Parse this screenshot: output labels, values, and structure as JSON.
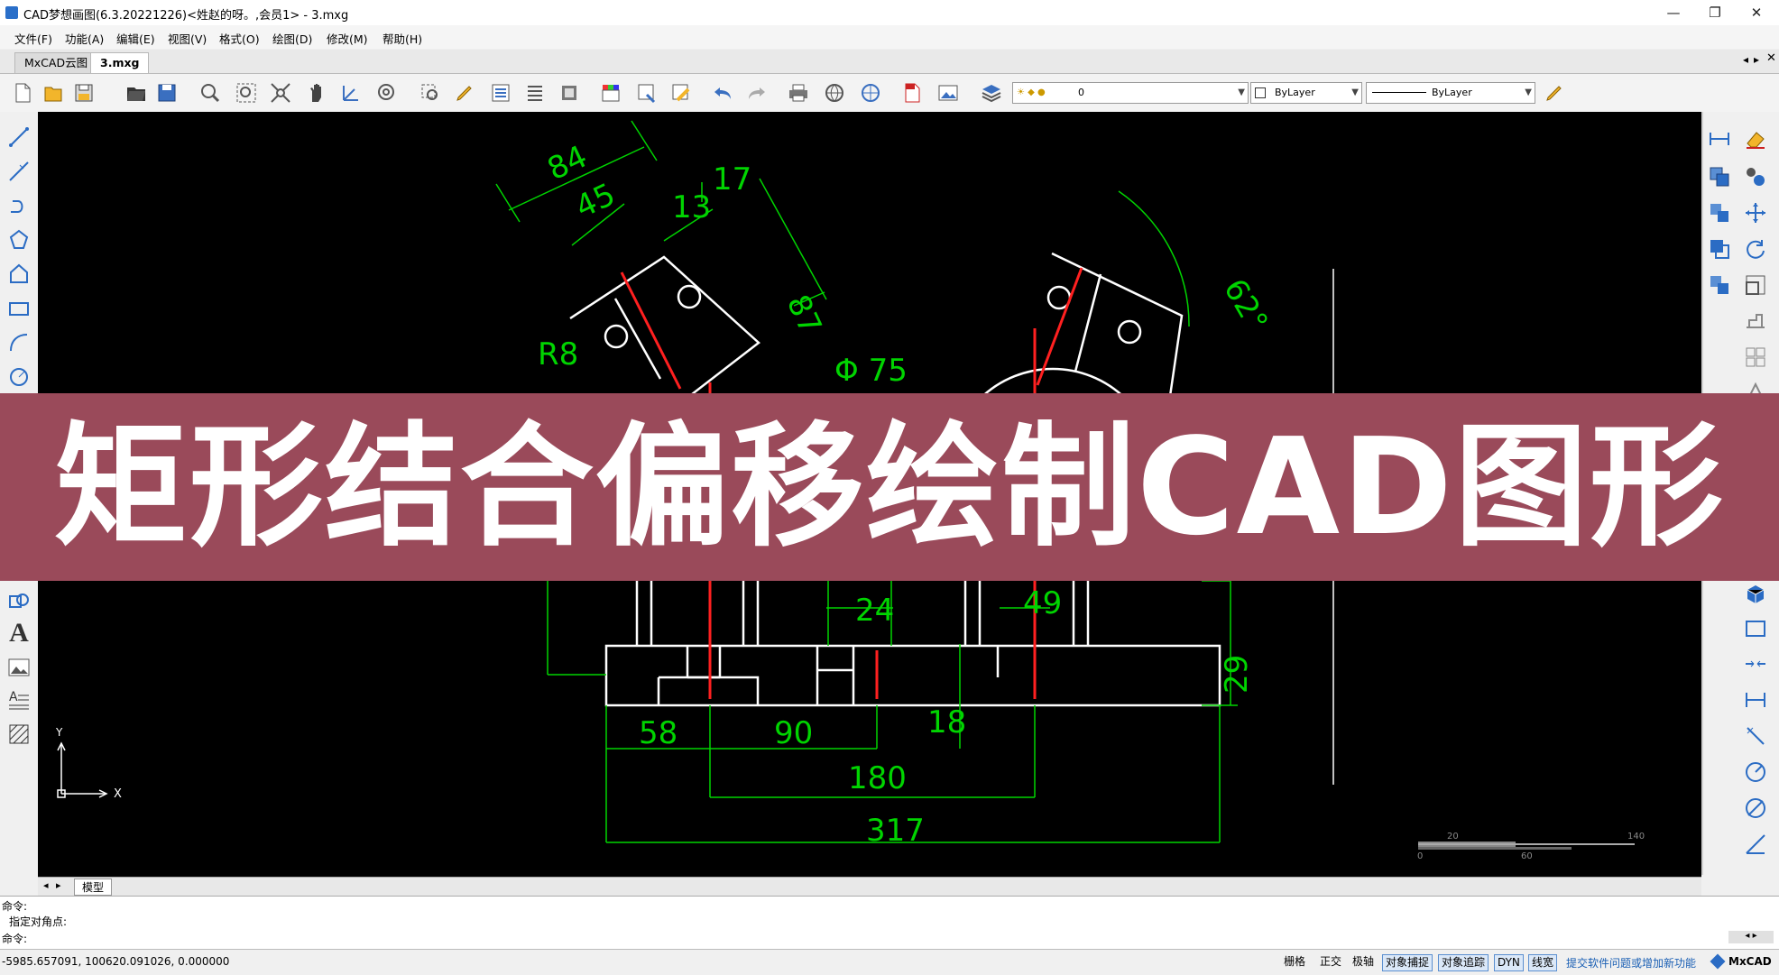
{
  "window": {
    "title": "CAD梦想画图(6.3.20221226)<姓赵的呀。,会员1> - 3.mxg",
    "controls": [
      "—",
      "❐",
      "✕"
    ]
  },
  "menu": {
    "items": [
      "文件(F)",
      "功能(A)",
      "编辑(E)",
      "视图(V)",
      "格式(O)",
      "绘图(D)",
      "修改(M)",
      "帮助(H)"
    ]
  },
  "tabs": {
    "items": [
      "MxCAD云图",
      "3.mxg"
    ],
    "active": "3.mxg"
  },
  "toolbar": {
    "layer_value": "0",
    "color_value": "ByLayer",
    "linetype_value": "ByLayer"
  },
  "drawing": {
    "dims": {
      "d84": "84",
      "d45": "45",
      "d13": "13",
      "d17": "17",
      "d87": "87",
      "r8": "R8",
      "phi75": "Φ 75",
      "a62": "62°",
      "d24": "24",
      "d49": "49",
      "d29": "29",
      "d18": "18",
      "d58": "58",
      "d90": "90",
      "d180": "180",
      "d317": "317"
    },
    "ucs": {
      "x": "X",
      "y": "Y"
    },
    "scale": {
      "s0": "0",
      "s20": "20",
      "s60": "60",
      "s140": "140"
    },
    "colors": {
      "dim": "#00d400",
      "geometry": "#ffffff",
      "center": "#ff2020",
      "background": "#000000"
    }
  },
  "banner": {
    "text": "矩形结合偏移绘制CAD图形",
    "color": "#9a4a5a"
  },
  "model_tab": {
    "label": "模型"
  },
  "command": {
    "lines": [
      "命令:",
      "指定对角点:",
      "命令:"
    ]
  },
  "status": {
    "coords": "-5985.657091,  100620.091026,  0.000000",
    "toggles": [
      "栅格",
      "正交",
      "极轴",
      "对象捕捉",
      "对象追踪",
      "DYN",
      "线宽"
    ],
    "active_toggles": [
      "对象捕捉",
      "对象追踪",
      "DYN",
      "线宽"
    ],
    "feedback_link": "提交软件问题或增加新功能",
    "brand": "MxCAD"
  }
}
